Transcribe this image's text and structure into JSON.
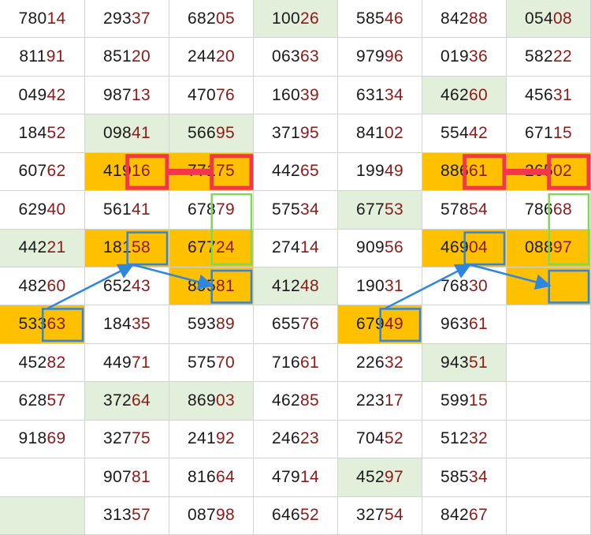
{
  "colors": {
    "green_highlight": "#e2efda",
    "orange_highlight": "#ffc000",
    "prefix_text": "#1a1a1a",
    "suffix_text": "#8b1a1a",
    "red_marker": "#f4364c",
    "blue_marker": "#2e86de",
    "lime_marker": "#7ed957"
  },
  "grid": {
    "columns": [
      [
        {
          "pre": "780",
          "suf": "14"
        },
        {
          "pre": "811",
          "suf": "91"
        },
        {
          "pre": "049",
          "suf": "42"
        },
        {
          "pre": "184",
          "suf": "52"
        },
        {
          "pre": "607",
          "suf": "62"
        },
        {
          "pre": "629",
          "suf": "40"
        },
        {
          "pre": "442",
          "suf": "21",
          "bg": "green"
        },
        {
          "pre": "482",
          "suf": "60"
        },
        {
          "pre": "533",
          "suf": "63",
          "bg": "orange"
        },
        {
          "pre": "452",
          "suf": "82"
        },
        {
          "pre": "628",
          "suf": "57"
        },
        {
          "pre": "918",
          "suf": "69"
        },
        {
          "pre": "",
          "suf": ""
        },
        {
          "pre": "",
          "suf": "",
          "bg": "green"
        }
      ],
      [
        {
          "pre": "293",
          "suf": "37"
        },
        {
          "pre": "851",
          "suf": "20"
        },
        {
          "pre": "987",
          "suf": "13"
        },
        {
          "pre": "098",
          "suf": "41",
          "bg": "green"
        },
        {
          "pre": "419",
          "suf": "16",
          "bg": "orange"
        },
        {
          "pre": "561",
          "suf": "41"
        },
        {
          "pre": "181",
          "suf": "58",
          "bg": "orange"
        },
        {
          "pre": "652",
          "suf": "43"
        },
        {
          "pre": "184",
          "suf": "35"
        },
        {
          "pre": "449",
          "suf": "71"
        },
        {
          "pre": "372",
          "suf": "64",
          "bg": "green"
        },
        {
          "pre": "327",
          "suf": "75"
        },
        {
          "pre": "907",
          "suf": "81"
        },
        {
          "pre": "313",
          "suf": "57"
        }
      ],
      [
        {
          "pre": "682",
          "suf": "05"
        },
        {
          "pre": "244",
          "suf": "20"
        },
        {
          "pre": "470",
          "suf": "76"
        },
        {
          "pre": "566",
          "suf": "95",
          "bg": "green"
        },
        {
          "pre": "771",
          "suf": "75",
          "bg": "orange"
        },
        {
          "pre": "678",
          "suf": "79"
        },
        {
          "pre": "677",
          "suf": "24",
          "bg": "orange"
        },
        {
          "pre": "895",
          "suf": "81",
          "bg": "orange"
        },
        {
          "pre": "593",
          "suf": "89"
        },
        {
          "pre": "575",
          "suf": "70"
        },
        {
          "pre": "869",
          "suf": "03",
          "bg": "green"
        },
        {
          "pre": "241",
          "suf": "92"
        },
        {
          "pre": "816",
          "suf": "64"
        },
        {
          "pre": "087",
          "suf": "98"
        }
      ],
      [
        {
          "pre": "100",
          "suf": "26",
          "bg": "green"
        },
        {
          "pre": "063",
          "suf": "63"
        },
        {
          "pre": "160",
          "suf": "39"
        },
        {
          "pre": "371",
          "suf": "95"
        },
        {
          "pre": "442",
          "suf": "65"
        },
        {
          "pre": "575",
          "suf": "34"
        },
        {
          "pre": "274",
          "suf": "14"
        },
        {
          "pre": "412",
          "suf": "48",
          "bg": "green"
        },
        {
          "pre": "655",
          "suf": "76"
        },
        {
          "pre": "716",
          "suf": "61"
        },
        {
          "pre": "462",
          "suf": "85"
        },
        {
          "pre": "246",
          "suf": "23"
        },
        {
          "pre": "479",
          "suf": "14"
        },
        {
          "pre": "646",
          "suf": "52"
        }
      ],
      [
        {
          "pre": "585",
          "suf": "46"
        },
        {
          "pre": "979",
          "suf": "96"
        },
        {
          "pre": "631",
          "suf": "34"
        },
        {
          "pre": "841",
          "suf": "02"
        },
        {
          "pre": "199",
          "suf": "49"
        },
        {
          "pre": "677",
          "suf": "53",
          "bg": "green"
        },
        {
          "pre": "909",
          "suf": "56"
        },
        {
          "pre": "190",
          "suf": "31"
        },
        {
          "pre": "679",
          "suf": "49",
          "bg": "orange"
        },
        {
          "pre": "226",
          "suf": "32"
        },
        {
          "pre": "223",
          "suf": "17"
        },
        {
          "pre": "704",
          "suf": "52"
        },
        {
          "pre": "452",
          "suf": "97",
          "bg": "green"
        },
        {
          "pre": "327",
          "suf": "54"
        }
      ],
      [
        {
          "pre": "842",
          "suf": "88"
        },
        {
          "pre": "019",
          "suf": "36"
        },
        {
          "pre": "462",
          "suf": "60",
          "bg": "green"
        },
        {
          "pre": "554",
          "suf": "42"
        },
        {
          "pre": "886",
          "suf": "61",
          "bg": "orange"
        },
        {
          "pre": "578",
          "suf": "54"
        },
        {
          "pre": "469",
          "suf": "04",
          "bg": "orange"
        },
        {
          "pre": "768",
          "suf": "30"
        },
        {
          "pre": "963",
          "suf": "61"
        },
        {
          "pre": "943",
          "suf": "51",
          "bg": "green"
        },
        {
          "pre": "599",
          "suf": "15"
        },
        {
          "pre": "512",
          "suf": "32"
        },
        {
          "pre": "585",
          "suf": "34"
        },
        {
          "pre": "842",
          "suf": "67"
        }
      ],
      [
        {
          "pre": "054",
          "suf": "08",
          "bg": "green"
        },
        {
          "pre": "582",
          "suf": "22"
        },
        {
          "pre": "456",
          "suf": "31"
        },
        {
          "pre": "671",
          "suf": "15"
        },
        {
          "pre": "265",
          "suf": "02",
          "bg": "orange"
        },
        {
          "pre": "786",
          "suf": "68"
        },
        {
          "pre": "088",
          "suf": "97",
          "bg": "orange"
        },
        {
          "pre": "",
          "suf": "",
          "bg": "orange"
        },
        {
          "pre": "",
          "suf": ""
        },
        {
          "pre": "",
          "suf": ""
        },
        {
          "pre": "",
          "suf": ""
        },
        {
          "pre": "",
          "suf": ""
        },
        {
          "pre": "",
          "suf": ""
        },
        {
          "pre": "",
          "suf": ""
        }
      ]
    ]
  },
  "markers": {
    "red_pairs": [
      {
        "from": {
          "col": 1,
          "row": 4
        },
        "to": {
          "col": 2,
          "row": 4
        }
      },
      {
        "from": {
          "col": 5,
          "row": 4
        },
        "to": {
          "col": 6,
          "row": 4
        }
      }
    ],
    "blue_paths": [
      {
        "cells": [
          {
            "col": 0,
            "row": 8
          },
          {
            "col": 1,
            "row": 6
          },
          {
            "col": 2,
            "row": 7
          }
        ]
      },
      {
        "cells": [
          {
            "col": 4,
            "row": 8
          },
          {
            "col": 5,
            "row": 6
          },
          {
            "col": 6,
            "row": 7
          }
        ]
      }
    ],
    "green_boxes": [
      {
        "col": 2,
        "row_start": 5,
        "row_end": 6
      },
      {
        "col": 6,
        "row_start": 5,
        "row_end": 6
      }
    ]
  }
}
